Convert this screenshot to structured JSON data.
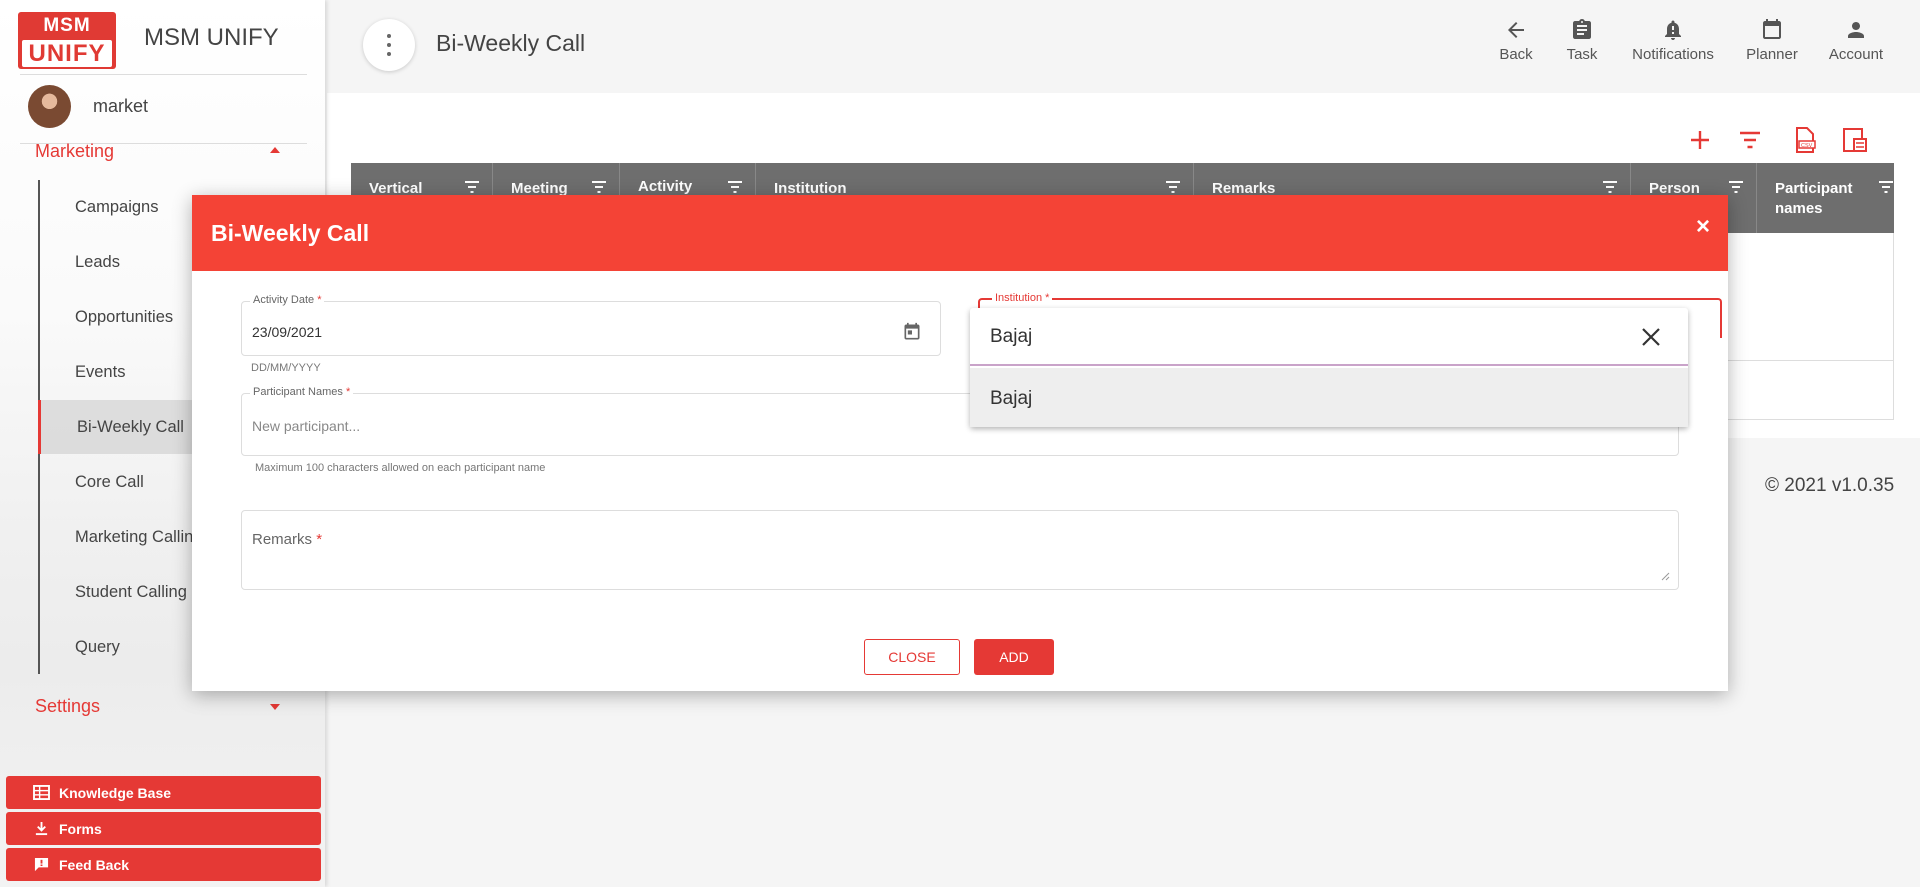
{
  "brand": {
    "logo_top": "MSM",
    "logo_bottom": "UNIFY",
    "name": "MSM UNIFY"
  },
  "user": {
    "name": "market"
  },
  "sidebar": {
    "marketing_label": "Marketing",
    "items": [
      {
        "label": "Campaigns"
      },
      {
        "label": "Leads"
      },
      {
        "label": "Opportunities"
      },
      {
        "label": "Events"
      },
      {
        "label": "Bi-Weekly Call"
      },
      {
        "label": "Core Call"
      },
      {
        "label": "Marketing Calling"
      },
      {
        "label": "Student Calling"
      },
      {
        "label": "Query"
      }
    ],
    "settings_label": "Settings",
    "buttons": [
      {
        "label": "Knowledge Base",
        "icon": "table-icon"
      },
      {
        "label": "Forms",
        "icon": "download-icon"
      },
      {
        "label": "Feed Back",
        "icon": "feedback-icon"
      }
    ]
  },
  "header": {
    "title": "Bi-Weekly Call",
    "actions": [
      {
        "label": "Back",
        "icon": "arrow-back-icon"
      },
      {
        "label": "Task",
        "icon": "clipboard-icon"
      },
      {
        "label": "Notifications",
        "icon": "bell-icon"
      },
      {
        "label": "Planner",
        "icon": "calendar-icon"
      },
      {
        "label": "Account",
        "icon": "person-icon"
      }
    ]
  },
  "table": {
    "columns": [
      {
        "label": "Vertical"
      },
      {
        "label": "Meeting"
      },
      {
        "label": "Activity Date"
      },
      {
        "label": "Institution"
      },
      {
        "label": "Remarks"
      },
      {
        "label": "Person"
      },
      {
        "label": "Participant names"
      }
    ]
  },
  "footer": {
    "copyright": "© 2021 v1.0.35"
  },
  "modal": {
    "title": "Bi-Weekly Call",
    "close_symbol": "×",
    "activity_date": {
      "label": "Activity Date",
      "value": "23/09/2021",
      "hint": "DD/MM/YYYY"
    },
    "institution": {
      "label": "Institution"
    },
    "participants": {
      "label": "Participant Names",
      "placeholder": "New participant...",
      "hint": "Maximum 100 characters allowed on each participant name"
    },
    "remarks": {
      "label": "Remarks"
    },
    "required_mark": "*",
    "close_label": "CLOSE",
    "add_label": "ADD"
  },
  "dropdown": {
    "search_value": "Bajaj",
    "options": [
      {
        "label": "Bajaj"
      }
    ]
  },
  "colors": {
    "accent": "#e53935",
    "header_red": "#f44336",
    "table_header": "#6e6e6e"
  }
}
